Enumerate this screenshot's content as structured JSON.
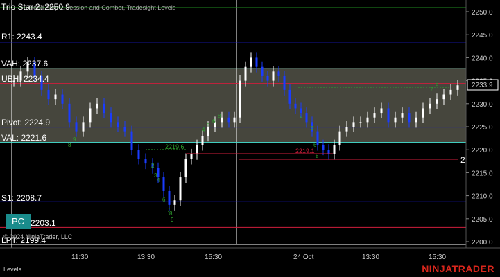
{
  "indicator_header": "Trend Stop 2 Session and Comber, Tradesight Levels",
  "copyright": "© 2024 NinjaTrader, LLC",
  "bottom_tab": "Levels",
  "brand": "NINJATRADER",
  "pc_button": "PC",
  "price_axis": {
    "ticks": [
      "2250.0",
      "2245.0",
      "2240.0",
      "2235.0",
      "2230.0",
      "2225.0",
      "2220.0",
      "2215.0",
      "2210.0",
      "2205.0",
      "2200.0"
    ],
    "current_price": "2233.9"
  },
  "time_axis": {
    "ticks": [
      "11:30",
      "13:30",
      "15:30",
      "24 Oct",
      "13:30",
      "15:30"
    ]
  },
  "levels": [
    {
      "label": "Trio Star 2: 2250.9",
      "price": 2250.9,
      "color": "#1f8a1f"
    },
    {
      "label": "R1: 2243.4",
      "price": 2243.4,
      "color": "#1a1acc"
    },
    {
      "label": "VAH: 2237.6",
      "price": 2237.6,
      "color": "#40e0d0"
    },
    {
      "label": "UBH: 2234.4",
      "price": 2234.4,
      "color": "#d01e3c"
    },
    {
      "label": "Pivot: 2224.9",
      "price": 2224.9,
      "color": "#1a1acc"
    },
    {
      "label": "VAL: 2221.6",
      "price": 2221.6,
      "color": "#40e0d0"
    },
    {
      "label": "S1: 2208.7",
      "price": 2208.7,
      "color": "#1a1acc"
    },
    {
      "label": "LBH: 2203.1",
      "price": 2203.1,
      "color": "#d01e3c"
    },
    {
      "label": "LPT: 2199.4",
      "price": 2199.4,
      "color": "#ffffff"
    }
  ],
  "annotations": {
    "level_2219a": "2219.6",
    "level_2219b": "2219.1",
    "right_marker": "2"
  },
  "colors": {
    "background": "#000000",
    "value_area": "#4a4a40",
    "up_bar": "#ffffff",
    "down_bar": "#1a3cff",
    "count_green": "#2ea02e"
  }
}
